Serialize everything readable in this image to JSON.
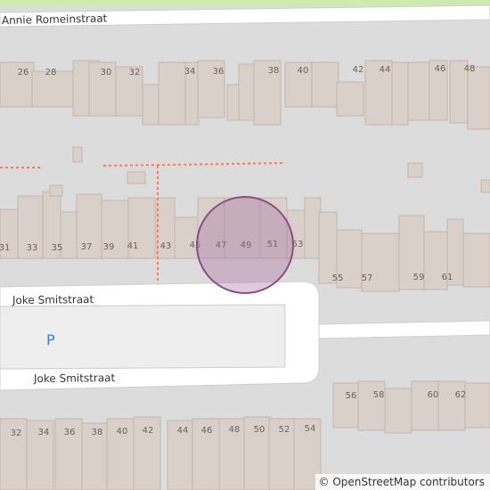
{
  "map": {
    "streets": {
      "top": "Annie Romeinstraat",
      "joke_upper": "Joke Smitstraat",
      "joke_lower": "Joke Smitstraat"
    },
    "parking_symbol": "P",
    "house_numbers": {
      "row1": [
        "26",
        "28",
        "30",
        "32",
        "34",
        "36",
        "38",
        "40",
        "42",
        "44",
        "46",
        "48"
      ],
      "row2": [
        "31",
        "33",
        "35",
        "37",
        "39",
        "41",
        "43",
        "45",
        "47",
        "49",
        "51",
        "53",
        "55",
        "57",
        "59",
        "61"
      ],
      "row3": [
        "56",
        "58",
        "60",
        "62"
      ],
      "row4": [
        "32",
        "34",
        "36",
        "38",
        "40",
        "42",
        "44",
        "46",
        "48",
        "50",
        "52",
        "54"
      ]
    },
    "attribution": "© OpenStreetMap contributors",
    "colors": {
      "building_fill": "#d9d0c9",
      "building_outline": "#c4b6ab",
      "road": "#ffffff",
      "background": "#dcdcdc",
      "grass": "#cdebb0",
      "footpath": "#f07f64",
      "marker": "#a56ba0"
    }
  }
}
